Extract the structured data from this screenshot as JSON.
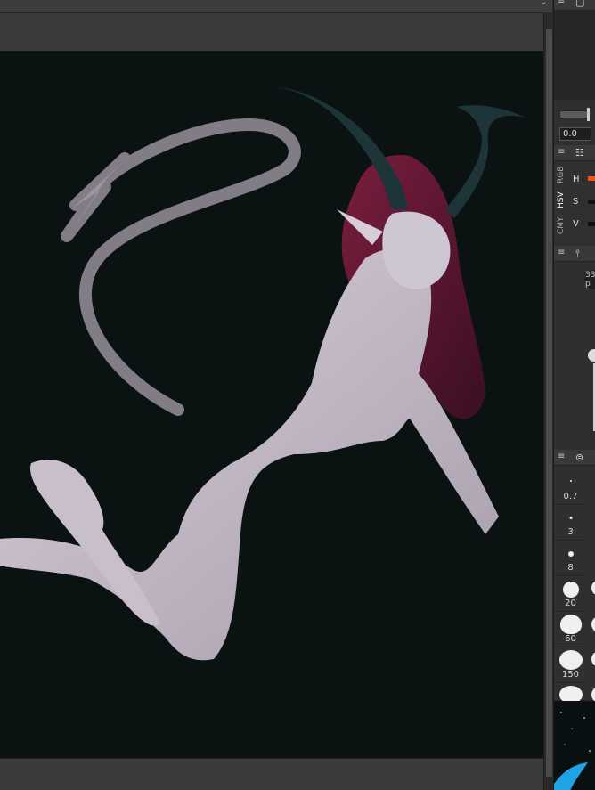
{
  "layer_panel": {
    "opacity_value": "0.0"
  },
  "color_panel": {
    "tabs": [
      "RGB",
      "HSV",
      "CMY"
    ],
    "labels": {
      "h": "H",
      "s": "S",
      "v": "V"
    },
    "h_color": "#ff4a1c"
  },
  "pen_panel": {
    "size_readout": "33",
    "size_unit": "p"
  },
  "brush_sizes": [
    "0.7",
    "3",
    "8",
    "20",
    "60",
    "150"
  ],
  "icons": {
    "menu": "menu-icon",
    "layers": "layers-icon",
    "color": "color-sliders-icon",
    "pen": "pen-settings-icon",
    "brush": "brush-size-icon"
  }
}
